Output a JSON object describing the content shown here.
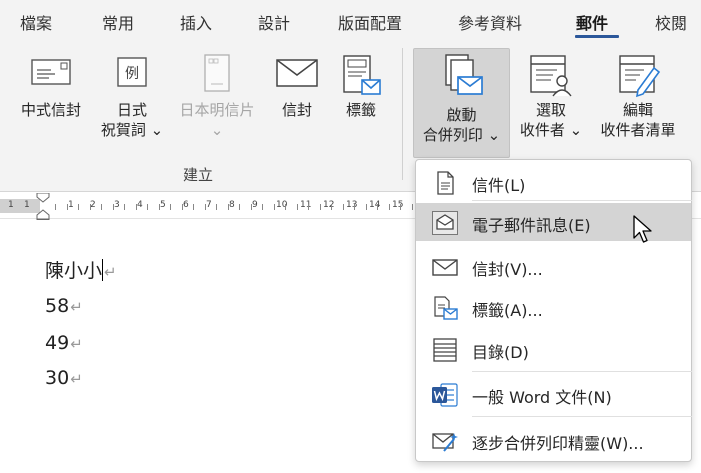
{
  "tabs": [
    "檔案",
    "常用",
    "插入",
    "設計",
    "版面配置",
    "參考資料",
    "郵件",
    "校閱"
  ],
  "active_tab": "郵件",
  "ribbon": {
    "create_group": {
      "label": "建立",
      "buttons": [
        {
          "line1": "中式信封",
          "line2": ""
        },
        {
          "line1": "日式",
          "line2": "祝賀詞 ⌄"
        },
        {
          "line1": "日本明信片",
          "line2": "⌄"
        },
        {
          "line1": "信封",
          "line2": ""
        },
        {
          "line1": "標籤",
          "line2": ""
        }
      ]
    },
    "merge_group": {
      "buttons": [
        {
          "line1": "啟動",
          "line2": "合併列印 ⌄"
        },
        {
          "line1": "選取",
          "line2": "收件者 ⌄"
        },
        {
          "line1": "編輯",
          "line2": "收件者清單"
        }
      ]
    },
    "example_char": "例"
  },
  "ruler": {
    "numbers": [
      "1",
      "1",
      "1",
      "2",
      "3",
      "4",
      "5",
      "6",
      "7",
      "8",
      "9",
      "10",
      "11",
      "12",
      "13",
      "14",
      "15"
    ]
  },
  "document": {
    "lines": [
      "陳小小",
      "58",
      "49",
      "30"
    ],
    "paragraph_mark": "↵"
  },
  "menu": {
    "items": [
      {
        "label": "信件(L)",
        "icon": "letter-icon"
      },
      {
        "label": "電子郵件訊息(E)",
        "icon": "email-message-icon"
      },
      {
        "label": "信封(V)...",
        "icon": "envelope-icon"
      },
      {
        "label": "標籤(A)...",
        "icon": "labels-icon"
      },
      {
        "label": "目錄(D)",
        "icon": "directory-icon"
      },
      {
        "label": "一般 Word 文件(N)",
        "icon": "word-document-icon"
      },
      {
        "label": "逐步合併列印精靈(W)...",
        "icon": "mail-merge-wizard-icon"
      }
    ],
    "hovered_index": 1
  },
  "colors": {
    "accent": "#2b579a",
    "icon_blue": "#2b7cd3",
    "ribbon_bg": "#f3f3f3",
    "hover_bg": "#d4d4d4"
  }
}
